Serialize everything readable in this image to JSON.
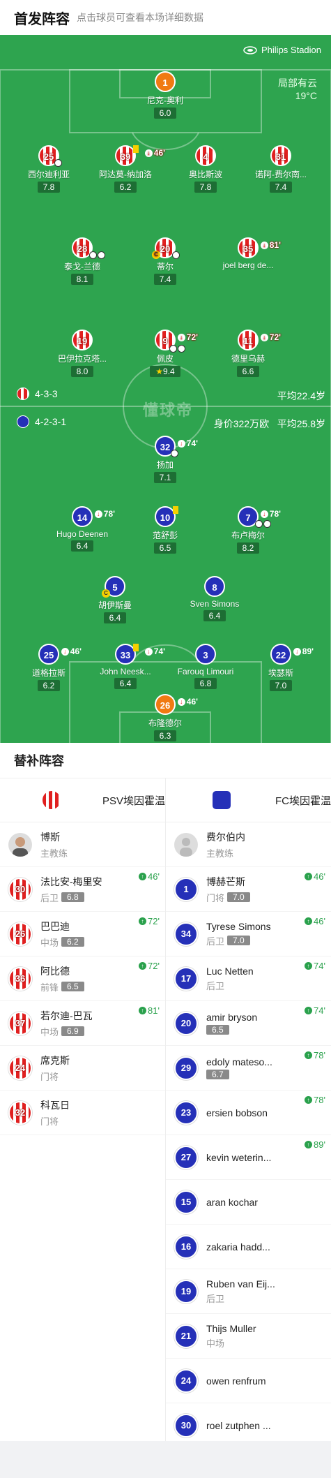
{
  "header": {
    "title": "首发阵容",
    "subtitle": "点击球员可查看本场详细数据"
  },
  "pitch": {
    "stadium": "Philips Stadion",
    "weather": "局部有云",
    "temperature": "19°C",
    "watermark": "懂球帝",
    "home": {
      "formation": "4-3-3",
      "avg_age": "平均22.4岁"
    },
    "away": {
      "formation": "4-2-3-1",
      "value": "身价322万欧",
      "avg_age": "平均25.8岁"
    }
  },
  "home_players": [
    {
      "num": "1",
      "name": "尼克-奥利",
      "rating": "6.0",
      "kit": "gk"
    },
    {
      "num": "25",
      "name": "西尔迪利亚",
      "rating": "7.8",
      "kit": "psv"
    },
    {
      "num": "39",
      "name": "阿达莫-纳加洛",
      "rating": "6.2",
      "kit": "psv",
      "sub": "46'"
    },
    {
      "num": "4",
      "name": "奥比斯波",
      "rating": "7.8",
      "kit": "psv"
    },
    {
      "num": "31",
      "name": "诺阿-费尔南...",
      "rating": "7.4",
      "kit": "psv"
    },
    {
      "num": "28",
      "name": "泰戈-兰德",
      "rating": "8.1",
      "kit": "psv"
    },
    {
      "num": "20",
      "name": "蒂尔",
      "rating": "7.4",
      "kit": "psv"
    },
    {
      "num": "35",
      "name": "joel berg de...",
      "rating": "",
      "kit": "psv",
      "sub": "81'"
    },
    {
      "num": "19",
      "name": "巴伊拉克塔...",
      "rating": "8.0",
      "kit": "psv"
    },
    {
      "num": "9",
      "name": "佩皮",
      "rating": "9.4",
      "kit": "psv",
      "sub": "72'"
    },
    {
      "num": "11",
      "name": "德里乌赫",
      "rating": "6.6",
      "kit": "psv",
      "sub": "72'"
    }
  ],
  "away_players": [
    {
      "num": "32",
      "name": "扬加",
      "rating": "7.1",
      "kit": "fc",
      "sub": "74'"
    },
    {
      "num": "14",
      "name": "Hugo Deenen",
      "rating": "6.4",
      "kit": "fc",
      "sub": "78'"
    },
    {
      "num": "10",
      "name": "范舒彭",
      "rating": "6.5",
      "kit": "fc"
    },
    {
      "num": "7",
      "name": "布卢梅尔",
      "rating": "8.2",
      "kit": "fc",
      "sub": "78'"
    },
    {
      "num": "5",
      "name": "胡伊斯曼",
      "rating": "6.4",
      "kit": "fc"
    },
    {
      "num": "8",
      "name": "Sven Simons",
      "rating": "6.4",
      "kit": "fc"
    },
    {
      "num": "25",
      "name": "道格拉斯",
      "rating": "6.2",
      "kit": "fc",
      "sub": "46'"
    },
    {
      "num": "33",
      "name": "John Neesk...",
      "rating": "6.4",
      "kit": "fc",
      "sub": "74'"
    },
    {
      "num": "3",
      "name": "Farouq Limouri",
      "rating": "6.8",
      "kit": "fc"
    },
    {
      "num": "22",
      "name": "埃瑟斯",
      "rating": "7.0",
      "kit": "fc",
      "sub": "89'"
    },
    {
      "num": "26",
      "name": "布隆德尔",
      "rating": "6.3",
      "kit": "gk",
      "sub": "46'"
    }
  ],
  "subs_title": "替补阵容",
  "home_bench": {
    "team": "PSV埃因霍温",
    "coach": {
      "name": "博斯",
      "role": "主教练"
    },
    "players": [
      {
        "num": "30",
        "name": "法比安-梅里安",
        "pos": "后卫",
        "rating": "6.8",
        "min": "46'"
      },
      {
        "num": "26",
        "name": "巴巴迪",
        "pos": "中场",
        "rating": "6.2",
        "min": "72'"
      },
      {
        "num": "36",
        "name": "阿比德",
        "pos": "前锋",
        "rating": "6.5",
        "min": "72'"
      },
      {
        "num": "37",
        "name": "若尔迪-巴瓦",
        "pos": "中场",
        "rating": "6.9",
        "min": "81'"
      },
      {
        "num": "24",
        "name": "席克斯",
        "pos": "门将",
        "rating": "",
        "min": ""
      },
      {
        "num": "32",
        "name": "科瓦日",
        "pos": "门将",
        "rating": "",
        "min": ""
      }
    ]
  },
  "away_bench": {
    "team": "FC埃因霍温",
    "coach": {
      "name": "费尔伯内",
      "role": "主教练"
    },
    "players": [
      {
        "num": "1",
        "name": "博赫芒斯",
        "pos": "门将",
        "rating": "7.0",
        "min": "46'"
      },
      {
        "num": "34",
        "name": "Tyrese Simons",
        "pos": "后卫",
        "rating": "7.0",
        "min": "46'"
      },
      {
        "num": "17",
        "name": "Luc Netten",
        "pos": "后卫",
        "rating": "",
        "min": "74'"
      },
      {
        "num": "20",
        "name": "amir bryson",
        "pos": "",
        "rating": "6.5",
        "min": "74'"
      },
      {
        "num": "29",
        "name": "edoly mateso...",
        "pos": "",
        "rating": "6.7",
        "min": "78'"
      },
      {
        "num": "23",
        "name": "ersien bobson",
        "pos": "",
        "rating": "",
        "min": "78'"
      },
      {
        "num": "27",
        "name": "kevin weterin...",
        "pos": "",
        "rating": "",
        "min": "89'"
      },
      {
        "num": "15",
        "name": "aran kochar",
        "pos": "",
        "rating": "",
        "min": ""
      },
      {
        "num": "16",
        "name": "zakaria hadd...",
        "pos": "",
        "rating": "",
        "min": ""
      },
      {
        "num": "19",
        "name": "Ruben van Eij...",
        "pos": "后卫",
        "rating": "",
        "min": ""
      },
      {
        "num": "21",
        "name": "Thijs Muller",
        "pos": "中场",
        "rating": "",
        "min": ""
      },
      {
        "num": "24",
        "name": "owen renfrum",
        "pos": "",
        "rating": "",
        "min": ""
      },
      {
        "num": "30",
        "name": "roel zutphen ...",
        "pos": "",
        "rating": "",
        "min": ""
      }
    ]
  },
  "colors": {
    "pitch": "#2ea44f",
    "psv_red": "#e02020",
    "fc_blue": "#2530b8",
    "gk_orange": "#f07a12",
    "sub_green": "#2aa14c"
  }
}
